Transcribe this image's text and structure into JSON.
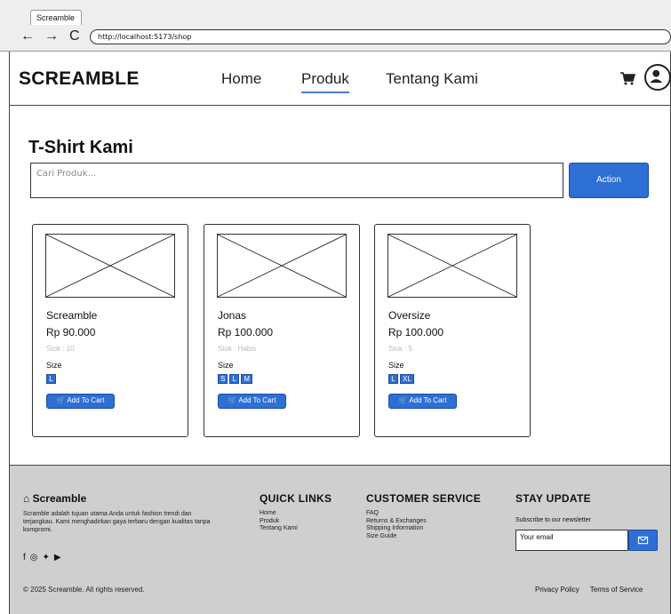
{
  "browser": {
    "tab_title": "Screamble",
    "back": "←",
    "forward": "→",
    "reload": "C",
    "url": "http://localhost:5173/shop"
  },
  "header": {
    "logo": "SCREAMBLE",
    "nav": [
      "Home",
      "Produk",
      "Tentang Kami"
    ],
    "active_nav": "Produk"
  },
  "main": {
    "title": "T-Shirt Kami",
    "search_placeholder": "Cari Produk...",
    "action_label": "Action"
  },
  "products": [
    {
      "name": "Screamble",
      "price": "Rp 90.000",
      "stock": "Stok : 10",
      "size_label": "Size",
      "sizes": [
        "L"
      ],
      "button": "Add To Cart"
    },
    {
      "name": "Jonas",
      "price": "Rp 100.000",
      "stock": "Stok : Habis",
      "size_label": "Size",
      "sizes": [
        "S",
        "L",
        "M"
      ],
      "button": "Add To Cart"
    },
    {
      "name": "Oversize",
      "price": "Rp 100.000",
      "stock": "Stok : 5",
      "size_label": "Size",
      "sizes": [
        "L",
        "XL"
      ],
      "button": "Add To Cart"
    }
  ],
  "footer": {
    "brand": "Screamble",
    "description": "Scramble adalah tujuan utama Anda untuk fashion trendi dan terjangkau. Kami menghadirkan gaya terbaru dengan kualitas tanpa kompromi.",
    "copyright": "© 2025 Screamble. All rights reserved.",
    "quick_links_title": "QUICK LINKS",
    "quick_links": [
      "Home",
      "Produk",
      "Tentang Kami"
    ],
    "customer_service_title": "CUSTOMER SERVICE",
    "customer_service": [
      "FAQ",
      "Returns & Exchanges",
      "Shipping Information",
      "Size Guide"
    ],
    "stay_update_title": "STAY UPDATE",
    "subscribe_text": "Subscribe to our newsletter",
    "email_placeholder": "Your email",
    "privacy": "Privacy Policy",
    "terms": "Terms of Service"
  },
  "colors": {
    "accent": "#2e6fd6",
    "footer_bg": "#cfcfcf"
  }
}
